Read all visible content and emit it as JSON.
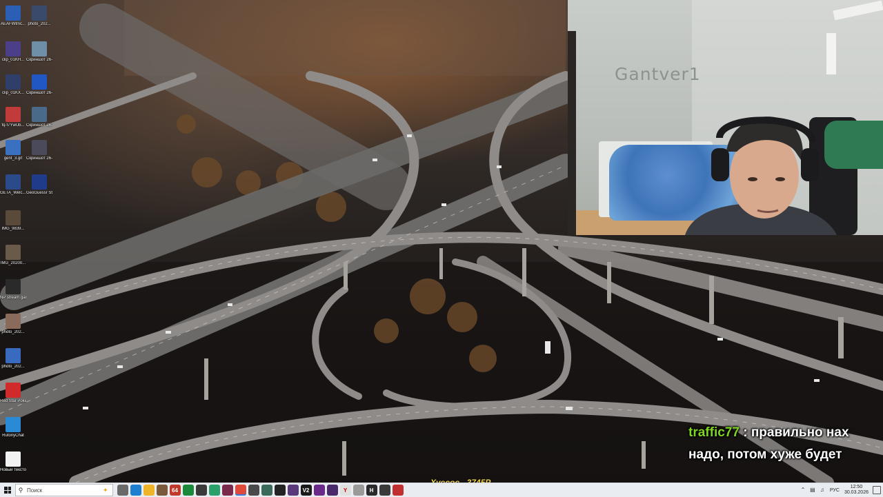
{
  "desktop_icons": [
    {
      "label": "AEAFWtmc...",
      "color": "#2b5fb5"
    },
    {
      "label": "photo_202...",
      "color": "#3a4a6a"
    },
    {
      "label": "clip_01KH...",
      "color": "#4b3f8a"
    },
    {
      "label": "Скриншот 26-03-20...",
      "color": "#6f8ea8"
    },
    {
      "label": "clip_01KX...",
      "color": "#2f3f6a"
    },
    {
      "label": "Скриншот 26-03-20...",
      "color": "#2157c2"
    },
    {
      "label": "fq-f7YwUb...",
      "color": "#c23b3b"
    },
    {
      "label": "Скриншот 26-03-20...",
      "color": "#4a6a8a"
    },
    {
      "label": "gent_3.gif",
      "color": "#3a70c0"
    },
    {
      "label": "Скриншот 26-03-20...",
      "color": "#4a4a5a"
    },
    {
      "label": "GETA_Welc... 2_gantver...",
      "color": "#2a4a8a"
    },
    {
      "label": "GeoGuessr Steam E...",
      "color": "#1f3b8a"
    },
    {
      "label": "IMG_9839...",
      "color": "#5a4a3a"
    },
    {
      "label": "IMG_20200...",
      "color": "#6a5a4a"
    },
    {
      "label": "NP stream gantver1...",
      "color": "#2a2a2a"
    },
    {
      "label": "photo_202...",
      "color": "#8a6a5a"
    },
    {
      "label": "photo_202...",
      "color": "#3a6ac0"
    },
    {
      "label": "Red Star Poker",
      "color": "#d12a2a"
    },
    {
      "label": "RutonyChat",
      "color": "#2a8ad6"
    },
    {
      "label": "Новый текстовый ...",
      "color": "#f2f2f2"
    }
  ],
  "webcam": {
    "brand_text": "Gantver1"
  },
  "chat": {
    "username": "traffic77",
    "separator": " : ",
    "message": "правильно нах надо, потом хуже будет"
  },
  "donation": {
    "text": "Хуесос - 3745Р"
  },
  "taskbar": {
    "search_placeholder": "Поиск",
    "apps": [
      {
        "icon": "task-view-icon",
        "label": "",
        "color": "#6a6a6a"
      },
      {
        "icon": "edge-icon",
        "label": "",
        "color": "#1e7fd0"
      },
      {
        "icon": "explorer-icon",
        "label": "",
        "color": "#f0b429"
      },
      {
        "icon": "app-icon",
        "label": "",
        "color": "#7a5a3a"
      },
      {
        "icon": "app-64-icon",
        "label": "64",
        "color": "#c0392b"
      },
      {
        "icon": "store-icon",
        "label": "",
        "color": "#1a8a3a"
      },
      {
        "icon": "terminal-icon",
        "label": "",
        "color": "#3a3a3a"
      },
      {
        "icon": "edge-dev-icon",
        "label": "",
        "color": "#2aa06a"
      },
      {
        "icon": "app-icon",
        "label": "",
        "color": "#7a2a4a"
      },
      {
        "icon": "chrome-icon",
        "label": "",
        "color": "#e04a3a"
      },
      {
        "icon": "app-icon",
        "label": "",
        "color": "#4a4a4a"
      },
      {
        "icon": "app-icon",
        "label": "",
        "color": "#3a6a5a"
      },
      {
        "icon": "obs-icon",
        "label": "",
        "color": "#222222"
      },
      {
        "icon": "app-icon",
        "label": "",
        "color": "#5a3a7a"
      },
      {
        "icon": "v2-icon",
        "label": "V2",
        "color": "#1a1a1a"
      },
      {
        "icon": "app-icon",
        "label": "",
        "color": "#6a2a8a"
      },
      {
        "icon": "app-icon",
        "label": "",
        "color": "#4a2a6a"
      },
      {
        "icon": "yandex-icon",
        "label": "Y",
        "color": "#e0e0e0"
      },
      {
        "icon": "app-icon",
        "label": "",
        "color": "#9a9a9a"
      },
      {
        "icon": "h-icon",
        "label": "H",
        "color": "#2a2a2a"
      },
      {
        "icon": "app-icon",
        "label": "",
        "color": "#3a3a3a"
      },
      {
        "icon": "app-icon",
        "label": "",
        "color": "#c03030"
      }
    ],
    "tray": {
      "language": "РУС",
      "time": "12:50",
      "date": "30.03.2026"
    }
  }
}
